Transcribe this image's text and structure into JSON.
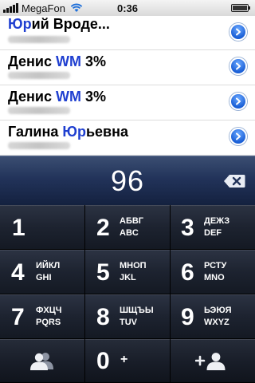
{
  "status_bar": {
    "carrier": "MegaFon",
    "time": "0:36",
    "signal_icon": "signal-bars-icon",
    "wifi_icon": "wifi-icon",
    "battery_icon": "battery-icon"
  },
  "results": [
    {
      "prefix": "",
      "highlight": "Юр",
      "suffix": "ий Вроде...",
      "disclosure_icon": "disclosure-arrow-icon"
    },
    {
      "prefix": "Денис ",
      "highlight": "WM",
      "suffix": " 3%",
      "disclosure_icon": "disclosure-arrow-icon"
    },
    {
      "prefix": "Денис ",
      "highlight": "WM",
      "suffix": " 3%",
      "disclosure_icon": "disclosure-arrow-icon"
    },
    {
      "prefix": "Галина ",
      "highlight": "Юр",
      "suffix": "ьевна",
      "disclosure_icon": "disclosure-arrow-icon"
    }
  ],
  "display": {
    "number": "96",
    "backspace_icon": "backspace-icon"
  },
  "keypad": {
    "keys": [
      {
        "digit": "1",
        "l1": "",
        "l2": ""
      },
      {
        "digit": "2",
        "l1": "АБВГ",
        "l2": "ABC"
      },
      {
        "digit": "3",
        "l1": "ДЕЖЗ",
        "l2": "DEF"
      },
      {
        "digit": "4",
        "l1": "ИЙКЛ",
        "l2": "GHI"
      },
      {
        "digit": "5",
        "l1": "МНОП",
        "l2": "JKL"
      },
      {
        "digit": "6",
        "l1": "РСТУ",
        "l2": "MNO"
      },
      {
        "digit": "7",
        "l1": "ФХЦЧ",
        "l2": "PQRS"
      },
      {
        "digit": "8",
        "l1": "ШЩЪЫ",
        "l2": "TUV"
      },
      {
        "digit": "9",
        "l1": "ЬЭЮЯ",
        "l2": "WXYZ"
      }
    ],
    "contacts_icon": "contacts-icon",
    "zero_digit": "0",
    "zero_sub": "+",
    "add_contact_plus": "+",
    "add_contact_icon": "add-contact-icon"
  },
  "colors": {
    "highlight": "#1f3fd0",
    "display_top": "#3b4e72",
    "display_bottom": "#14213f",
    "key_top": "#2c3343",
    "key_bottom": "#141923"
  }
}
